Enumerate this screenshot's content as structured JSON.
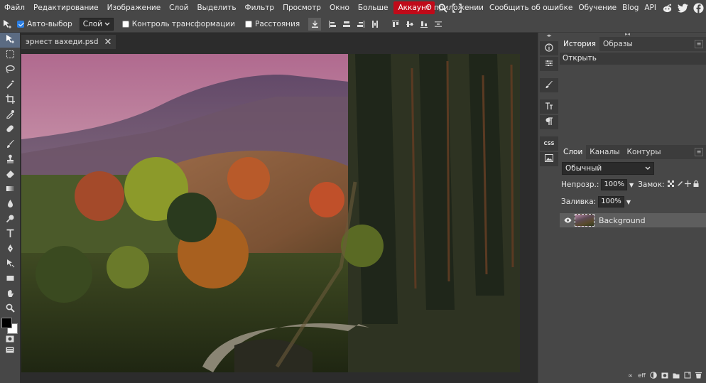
{
  "menu": {
    "items": [
      "Файл",
      "Редактирование",
      "Изображение",
      "Слой",
      "Выделить",
      "Фильтр",
      "Просмотр",
      "Окно",
      "Больше"
    ],
    "account_label": "Аккаунт",
    "right_items": [
      "О приложении",
      "Сообщить об ошибке",
      "Обучение",
      "Blog",
      "API"
    ],
    "account_color": "#c00a19"
  },
  "options": {
    "auto_select_label": "Авто-выбор",
    "auto_select_checked": true,
    "layer_select_value": "Слой",
    "transform_label": "Контроль трансформации",
    "distances_label": "Расстояния"
  },
  "document": {
    "tab_title": "эрнест вахеди.psd",
    "close_glyph": "✕"
  },
  "panels": {
    "history_tabs": [
      "История",
      "Образы"
    ],
    "history_entries": [
      "Открыть"
    ],
    "layers_tabs": [
      "Слои",
      "Каналы",
      "Контуры"
    ],
    "blend_mode": "Обычный",
    "opacity_label": "Непрозр.:",
    "opacity_value": "100%",
    "lock_label": "Замок:",
    "fill_label": "Заливка:",
    "fill_value": "100%",
    "layers": [
      {
        "name": "Background",
        "visible": true
      }
    ],
    "strip_css_label": "CSS"
  },
  "colors": {
    "foreground": "#000000",
    "background": "#ffffff",
    "active_tool": "#5b6b82"
  }
}
